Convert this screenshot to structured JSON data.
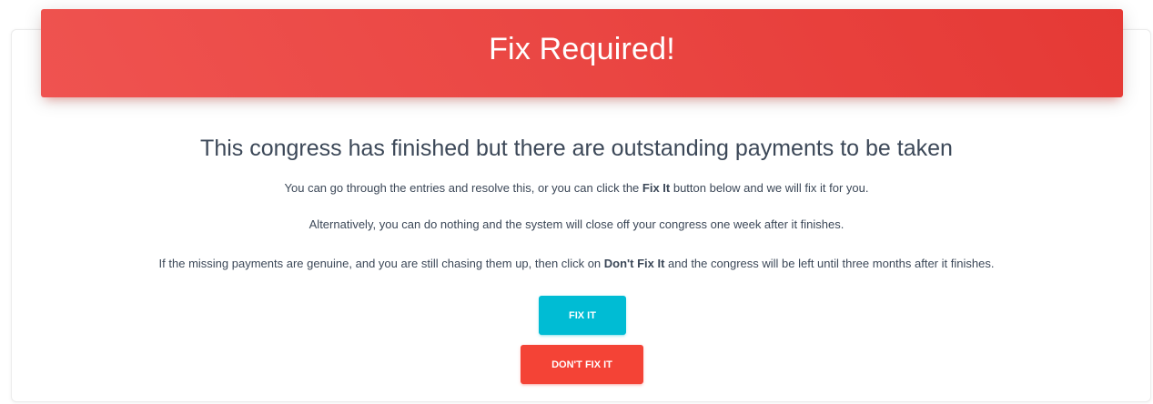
{
  "header": {
    "title": "Fix Required!"
  },
  "main": {
    "subtitle": "This congress has finished but there are outstanding payments to be taken",
    "paragraph1": {
      "before": "You can go through the entries and resolve this, or you can click the ",
      "bold": "Fix It",
      "after": " button below and we will fix it for you."
    },
    "paragraph2": "Alternatively, you can do nothing and the system will close off your congress one week after it finishes.",
    "paragraph3": {
      "before": "If the missing payments are genuine, and you are still chasing them up, then click on ",
      "bold": "Don't Fix It",
      "after": " and the congress will be left until three months after it finishes."
    }
  },
  "actions": {
    "fix_label": "FIX IT",
    "dont_fix_label": "DON'T FIX IT"
  },
  "colors": {
    "header_red": "#e53935",
    "fix_button": "#00bcd4",
    "dont_fix_button": "#f44336",
    "text": "#3c4858"
  }
}
